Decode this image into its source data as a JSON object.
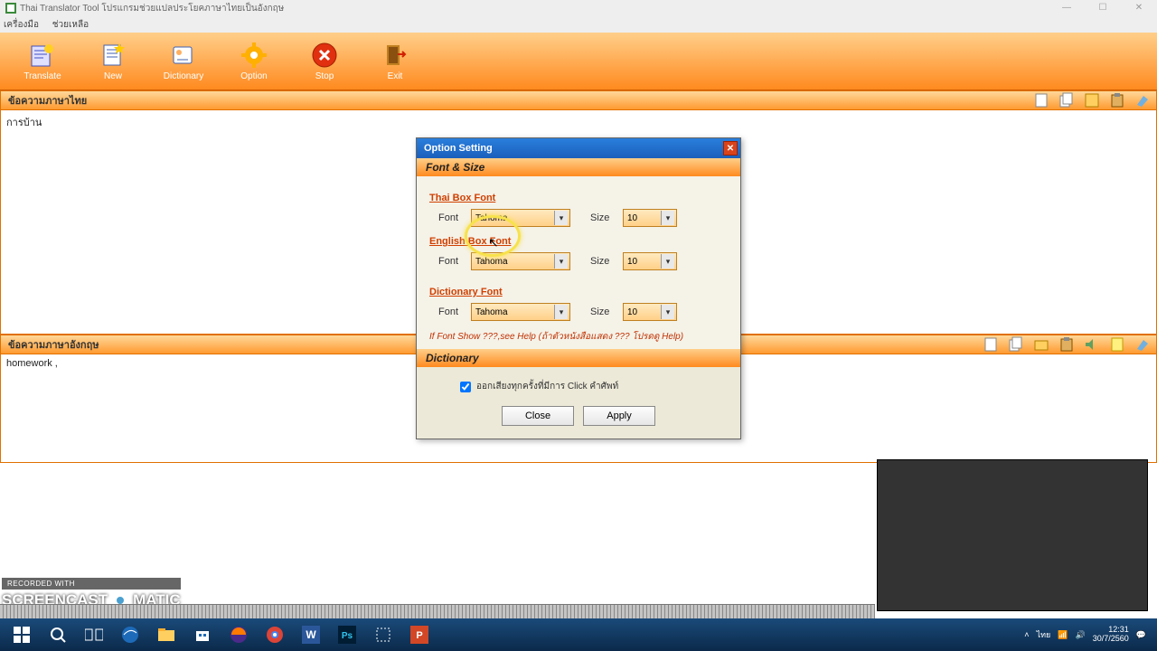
{
  "window": {
    "title": "Thai Translator Tool  โปรแกรมช่วยแปลประโยคภาษาไทยเป็นอังกฤษ"
  },
  "menu": {
    "tools": "เครื่องมือ",
    "help": "ช่วยเหลือ"
  },
  "toolbar": {
    "translate": "Translate",
    "new": "New",
    "dictionary": "Dictionary",
    "option": "Option",
    "stop": "Stop",
    "exit": "Exit"
  },
  "sections": {
    "thai_header": "ข้อความภาษาไทย",
    "english_header": "ข้อความภาษาอังกฤษ"
  },
  "content": {
    "thai_text": "การบ้าน",
    "english_text": "homework ,"
  },
  "dialog": {
    "title": "Option Setting",
    "section_font": "Font & Size",
    "thai_box_font": "Thai Box Font",
    "english_box_font": "English Box Font",
    "dictionary_font": "Dictionary Font",
    "font_label": "Font",
    "size_label": "Size",
    "font_value": "Tahoma",
    "size_value": "10",
    "hint": "If Font Show ???,see Help (ถ้าตัวหนังสือแสดง ??? โปรดดู Help)",
    "section_dict": "Dictionary",
    "speak_checkbox": "ออกเสียงทุกครั้งที่มีการ Click คำศัพท์",
    "close": "Close",
    "apply": "Apply"
  },
  "watermark": {
    "rec": "RECORDED WITH",
    "brand_a": "SCREENCAST",
    "brand_b": "MATIC"
  },
  "taskbar": {
    "lang": "ไทย",
    "time": "12:31",
    "date": "30/7/2560"
  }
}
